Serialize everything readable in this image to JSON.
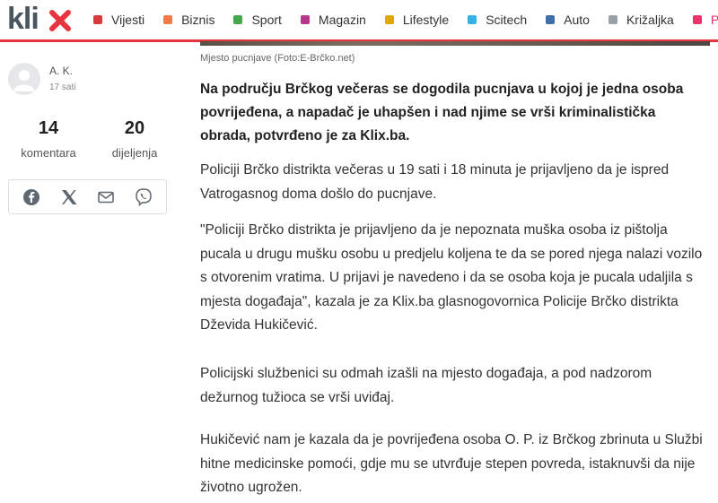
{
  "nav": {
    "logo_text": "klix",
    "items": [
      {
        "label": "Vijesti",
        "color": "#d9383c"
      },
      {
        "label": "Biznis",
        "color": "#f07b46"
      },
      {
        "label": "Sport",
        "color": "#45a84a"
      },
      {
        "label": "Magazin",
        "color": "#b8378a"
      },
      {
        "label": "Lifestyle",
        "color": "#e0a800"
      },
      {
        "label": "Scitech",
        "color": "#34b3e8"
      },
      {
        "label": "Auto",
        "color": "#3f6ea8"
      },
      {
        "label": "Križaljka",
        "color": "#9aa0a8"
      },
      {
        "label": "Posao",
        "color": "#e8346a"
      }
    ]
  },
  "author": {
    "name": "A. K.",
    "time": "17 sati"
  },
  "stats": {
    "comments_count": "14",
    "comments_label": "komentara",
    "shares_count": "20",
    "shares_label": "dijeljenja"
  },
  "share": {
    "icons": [
      "facebook-icon",
      "x-icon",
      "mail-icon",
      "viber-icon"
    ]
  },
  "article": {
    "caption": "Mjesto pucnjave (Foto:E-Brčko.net)",
    "lead": "Na području Brčkog večeras se dogodila pucnjava u kojoj je jedna osoba povrijeđena, a napadač je uhapšen i nad njime se vrši kriminalistička obrada, potvrđeno je za Klix.ba.",
    "paragraphs": [
      "Policiji Brčko distrikta večeras u 19 sati i 18 minuta je prijavljeno da je ispred Vatrogasnog doma došlo do pucnjave.",
      "\"Policiji Brčko distrikta je prijavljeno da je nepoznata muška osoba iz pištolja pucala u drugu mušku osobu u predjelu koljena te da se pored njega nalazi vozilo s otvorenim vratima. U prijavi je navedeno i da se osoba koja je pucala udaljila s mjesta događaja\", kazala je za Klix.ba glasnogovornica Policije Brčko distrikta Dževida Hukičević.",
      "Policijski službenici su odmah izašli na mjesto događaja, a pod nadzorom dežurnog tužioca se vrši uviđaj.",
      "Hukičević nam je kazala da je povrijeđena osoba O. P. iz Brčkog zbrinuta u Službi hitne medicinske pomoći, gdje mu se utvrđuje stepen povreda, istaknuvši da nije životno ugrožen."
    ]
  }
}
